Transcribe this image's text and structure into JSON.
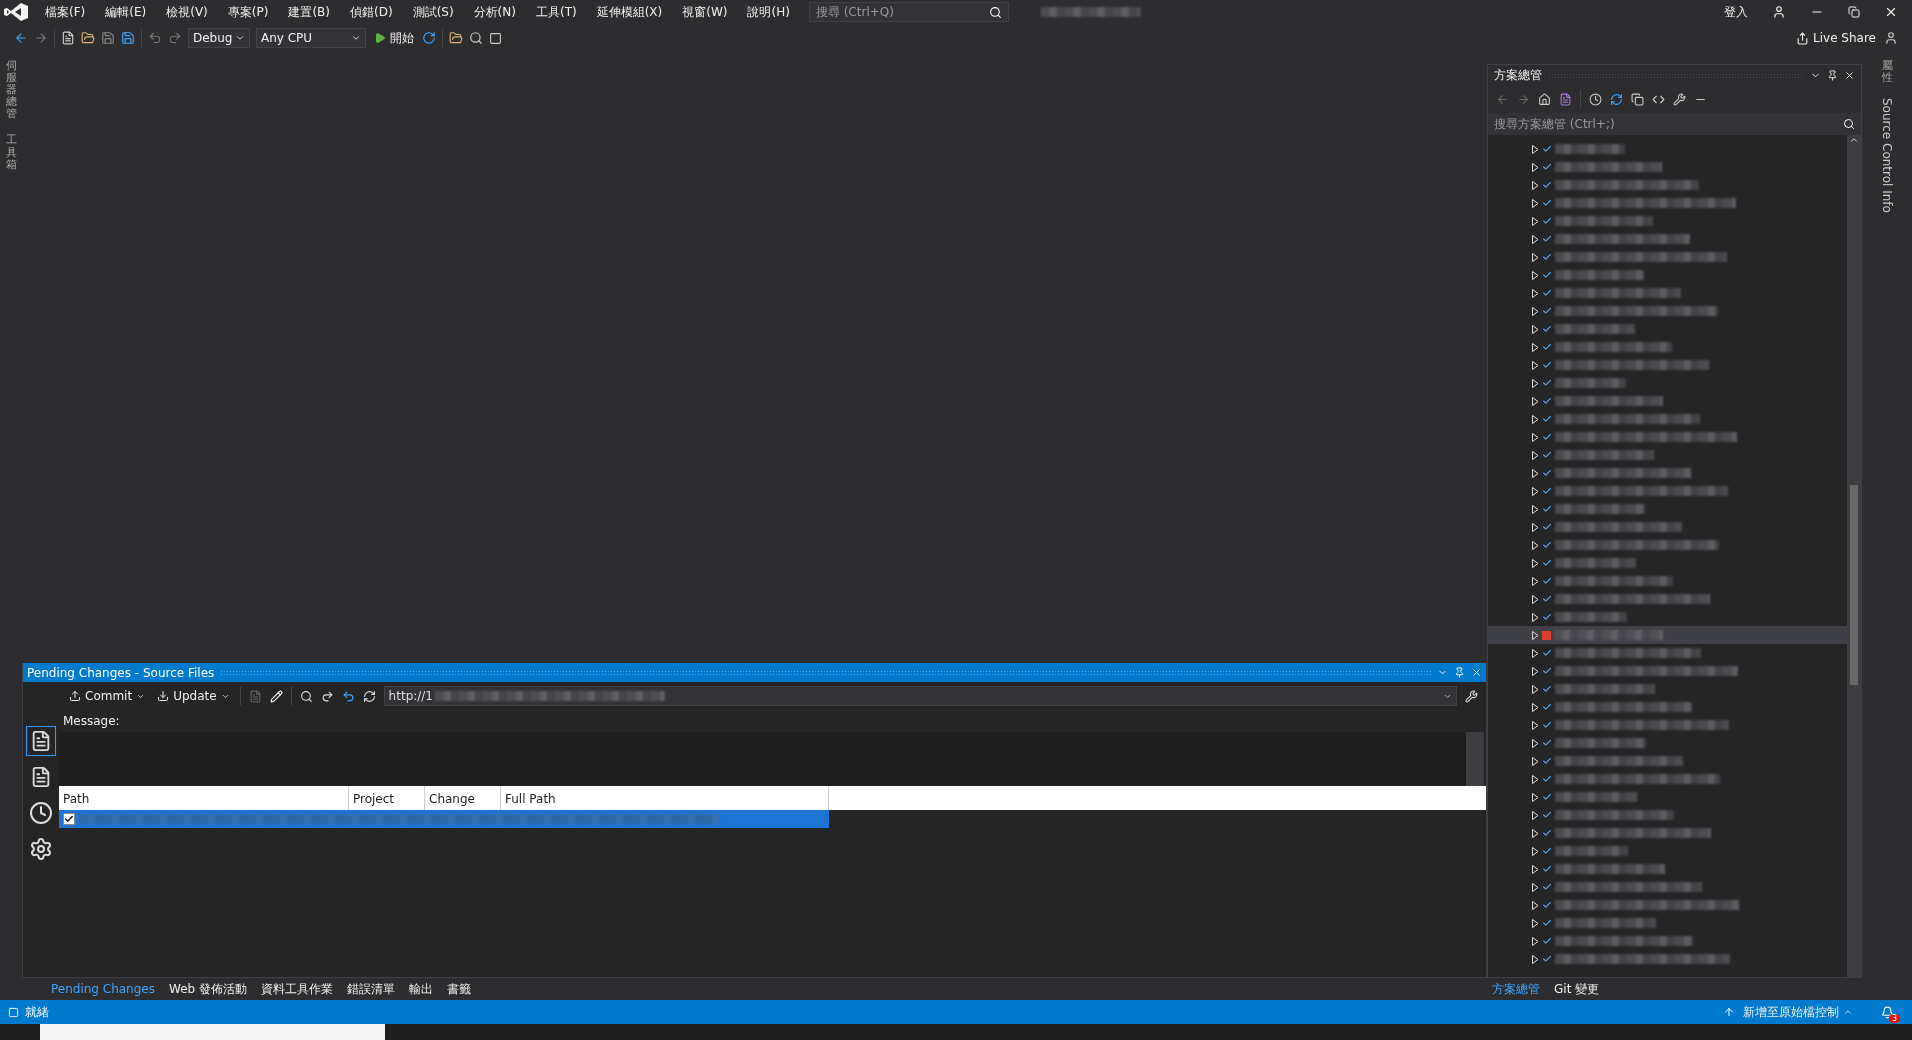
{
  "menu_bar": {
    "items": [
      "檔案(F)",
      "編輯(E)",
      "檢視(V)",
      "專案(P)",
      "建置(B)",
      "偵錯(D)",
      "測試(S)",
      "分析(N)",
      "工具(T)",
      "延伸模組(X)",
      "視窗(W)",
      "說明(H)"
    ],
    "search": {
      "placeholder": "搜尋 (Ctrl+Q)"
    },
    "sign_in": "登入"
  },
  "toolbar": {
    "configuration": "Debug",
    "platform": "Any CPU",
    "start": "開始",
    "live_share": "Live Share"
  },
  "left_strip": [
    "伺服器總管",
    "工具箱"
  ],
  "right_strip": {
    "properties": "屬性",
    "source_control": "Source Control Info"
  },
  "pending_changes": {
    "title": "Pending Changes - Source Files",
    "commit": "Commit",
    "update": "Update",
    "url": "http://1",
    "message_label": "Message:",
    "columns": [
      "Path",
      "Project",
      "Change",
      "Full Path"
    ],
    "rows": [
      {
        "checked": true,
        "selected": true
      }
    ]
  },
  "bottom_tabs": [
    {
      "label": "Pending Changes",
      "selected": true
    },
    {
      "label": "Web 發佈活動",
      "selected": false
    },
    {
      "label": "資料工具作業",
      "selected": false
    },
    {
      "label": "錯誤清單",
      "selected": false
    },
    {
      "label": "輸出",
      "selected": false
    },
    {
      "label": "書籤",
      "selected": false
    }
  ],
  "solution_explorer": {
    "title": "方案總管",
    "search": {
      "placeholder": "搜尋方案總管 (Ctrl+;)"
    },
    "items": [
      {
        "modified": false,
        "selected": false
      },
      {
        "modified": false,
        "selected": false
      },
      {
        "modified": false,
        "selected": false
      },
      {
        "modified": false,
        "selected": false
      },
      {
        "modified": false,
        "selected": false
      },
      {
        "modified": false,
        "selected": false
      },
      {
        "modified": false,
        "selected": false
      },
      {
        "modified": false,
        "selected": false
      },
      {
        "modified": false,
        "selected": false
      },
      {
        "modified": false,
        "selected": false
      },
      {
        "modified": false,
        "selected": false
      },
      {
        "modified": false,
        "selected": false
      },
      {
        "modified": false,
        "selected": false
      },
      {
        "modified": false,
        "selected": false
      },
      {
        "modified": false,
        "selected": false
      },
      {
        "modified": false,
        "selected": false
      },
      {
        "modified": false,
        "selected": false
      },
      {
        "modified": false,
        "selected": false
      },
      {
        "modified": false,
        "selected": false
      },
      {
        "modified": false,
        "selected": false
      },
      {
        "modified": false,
        "selected": false
      },
      {
        "modified": false,
        "selected": false
      },
      {
        "modified": false,
        "selected": false
      },
      {
        "modified": false,
        "selected": false
      },
      {
        "modified": false,
        "selected": false
      },
      {
        "modified": false,
        "selected": false
      },
      {
        "modified": false,
        "selected": false
      },
      {
        "modified": true,
        "selected": true
      },
      {
        "modified": false,
        "selected": false
      },
      {
        "modified": false,
        "selected": false
      },
      {
        "modified": false,
        "selected": false
      },
      {
        "modified": false,
        "selected": false
      },
      {
        "modified": false,
        "selected": false
      },
      {
        "modified": false,
        "selected": false
      },
      {
        "modified": false,
        "selected": false
      },
      {
        "modified": false,
        "selected": false
      },
      {
        "modified": false,
        "selected": false
      },
      {
        "modified": false,
        "selected": false
      },
      {
        "modified": false,
        "selected": false
      },
      {
        "modified": false,
        "selected": false
      },
      {
        "modified": false,
        "selected": false
      },
      {
        "modified": false,
        "selected": false
      },
      {
        "modified": false,
        "selected": false
      },
      {
        "modified": false,
        "selected": false
      },
      {
        "modified": false,
        "selected": false
      },
      {
        "modified": false,
        "selected": false
      }
    ],
    "tabs": [
      {
        "label": "方案總管",
        "selected": true
      },
      {
        "label": "Git 變更",
        "selected": false
      }
    ]
  },
  "status_bar": {
    "text": "就緒",
    "source_control": "新增至原始檔控制",
    "notifications": "3"
  }
}
